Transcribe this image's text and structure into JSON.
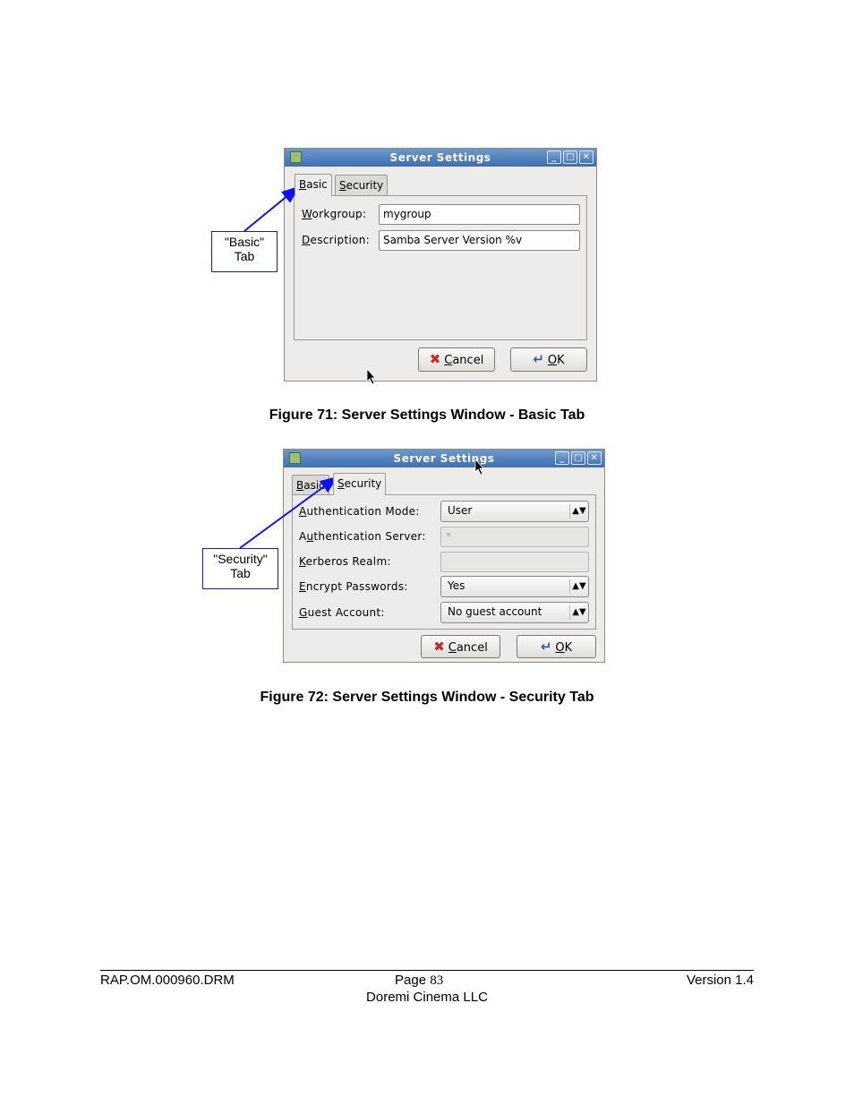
{
  "window_title": "Server Settings",
  "figure1": {
    "tabs": {
      "basic_label_u": "B",
      "basic_label_rest": "asic",
      "security_label_u": "S",
      "security_label_rest": "ecurity"
    },
    "fields": [
      {
        "label_u": "W",
        "label_rest": "orkgroup:",
        "value": "mygroup"
      },
      {
        "label_u": "D",
        "label_rest": "escription:",
        "value": "Samba Server Version %v"
      }
    ],
    "cancel_u": "C",
    "cancel_rest": "ancel",
    "ok_u": "O",
    "ok_rest": "K",
    "callout_line1": "\"Basic\"",
    "callout_line2": "Tab",
    "caption": "Figure 71: Server Settings Window - Basic Tab"
  },
  "figure2": {
    "tabs": {
      "basic_label_u": "B",
      "basic_label_rest": "asic",
      "security_label_u": "S",
      "security_label_rest": "ecurity"
    },
    "rows": [
      {
        "label_u": "A",
        "label_rest": "uthentication Mode:",
        "value": "User"
      },
      {
        "label_pre": "A",
        "label_u": "u",
        "label_rest": "thentication Server:",
        "value": "*"
      },
      {
        "label_u": "K",
        "label_rest": "erberos Realm:",
        "value": ""
      },
      {
        "label_u": "E",
        "label_rest": "ncrypt Passwords:",
        "value": "Yes"
      },
      {
        "label_u": "G",
        "label_rest": "uest Account:",
        "value": "No guest account"
      }
    ],
    "cancel_u": "C",
    "cancel_rest": "ancel",
    "ok_u": "O",
    "ok_rest": "K",
    "callout_line1": "\"Security\"",
    "callout_line2": "Tab",
    "caption": "Figure 72: Server Settings Window - Security Tab"
  },
  "footer": {
    "doc_id": "RAP.OM.000960.DRM",
    "page_label": "Page",
    "page_number": "83",
    "version": "Version 1.4",
    "company": "Doremi Cinema LLC"
  },
  "colors": {
    "titlebar": "#4a7bbd",
    "callout_arrow": "#1010ee",
    "cancel_icon": "#c42a2a"
  }
}
